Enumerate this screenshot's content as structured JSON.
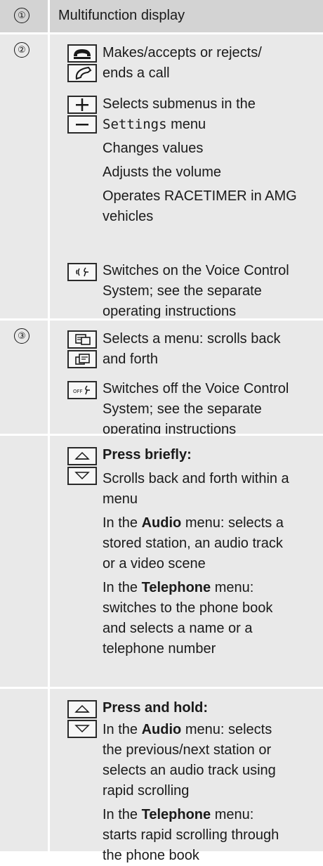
{
  "rows": [
    {
      "marker": "①",
      "text": "Multifunction display"
    },
    {
      "marker": "②",
      "entries": [
        {
          "icon_names": [
            "phone-accept-icon",
            "phone-end-icon"
          ],
          "lines": [
            "Makes/accepts or rejects/",
            "ends a call"
          ]
        },
        {
          "icon_names": [
            "plus-icon",
            "minus-icon"
          ],
          "line1": "Selects submenus in the",
          "line2_mono": "Settings",
          "line2_rest": " menu",
          "extra": [
            "Changes values",
            "Adjusts the volume",
            "Operates RACETIMER in AMG",
            "vehicles"
          ]
        },
        {
          "icon_names": [
            "voice-control-on-icon"
          ],
          "lines": [
            "Switches on the Voice Control",
            "System; see the separate",
            "operating instructions"
          ]
        }
      ]
    },
    {
      "marker": "③",
      "entries": [
        {
          "icon_names": [
            "menu-back-icon",
            "menu-forward-icon"
          ],
          "lines": [
            "Selects a menu: scrolls back",
            "and forth"
          ]
        },
        {
          "icon_names": [
            "voice-control-off-icon"
          ],
          "off_label": "OFF",
          "lines": [
            "Switches off the Voice Control",
            "System; see the separate",
            "operating instructions"
          ]
        }
      ]
    },
    {
      "marker": "",
      "entries": [
        {
          "icon_names": [
            "arrow-up-icon",
            "arrow-down-icon"
          ],
          "heading": "Press briefly:",
          "p1": [
            "Scrolls back and forth within a",
            "menu"
          ],
          "p2_pre": "In the ",
          "p2_bold": "Audio",
          "p2_post": " menu: selects a",
          "p2_lines": [
            "stored station, an audio track",
            "or a video scene"
          ],
          "p3_pre": "In the ",
          "p3_bold": "Telephone",
          "p3_post": " menu:",
          "p3_lines": [
            "switches to the phone book",
            "and selects a name or a",
            "telephone number"
          ]
        }
      ]
    },
    {
      "marker": "",
      "entries": [
        {
          "icon_names": [
            "arrow-up-icon",
            "arrow-down-icon"
          ],
          "heading": "Press and hold:",
          "p1_pre": "In the ",
          "p1_bold": "Audio",
          "p1_post": " menu: selects",
          "p1_lines": [
            "the previous/next station or",
            "selects an audio track using",
            "rapid scrolling"
          ],
          "p2_pre": "In the ",
          "p2_bold": "Telephone",
          "p2_post": " menu:",
          "p2_lines": [
            "starts rapid scrolling through",
            "the phone book"
          ]
        }
      ]
    }
  ]
}
